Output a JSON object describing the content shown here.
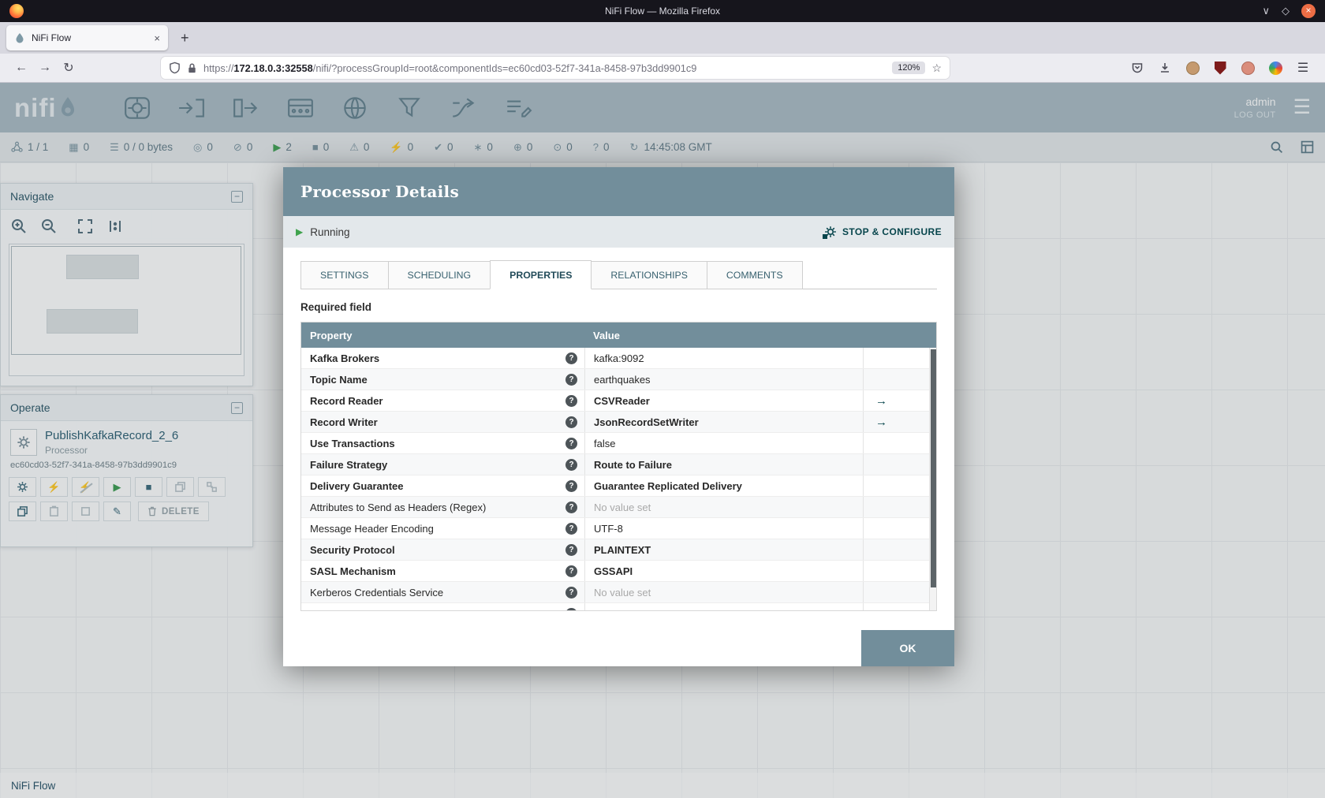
{
  "browser": {
    "window_title": "NiFi Flow — Mozilla Firefox",
    "tab_title": "NiFi Flow",
    "url_scheme": "https://",
    "url_host": "172.18.0.3:32558",
    "url_path": "/nifi/?processGroupId=root&componentIds=ec60cd03-52f7-341a-8458-97b3dd9901c9",
    "zoom_level": "120%"
  },
  "icons": {
    "close": "×",
    "menu": "☰",
    "chevron-down": "∨",
    "restore": "◇",
    "back": "←",
    "forward": "→",
    "reload": "↻",
    "star": "☆",
    "plus": "+",
    "collapse": "−",
    "help": "?",
    "goto": "→",
    "bolt": "⚡",
    "play": "▶",
    "stop": "■",
    "pencil": "✎",
    "threads": "▦",
    "queue": "☰",
    "transmitting": "◎",
    "not-transmitting": "⊘",
    "running": "▶",
    "stopped": "■",
    "invalid": "⚠",
    "disabled": "⚡",
    "up-to-date": "✔",
    "locally-modified": "∗",
    "stale": "⊕",
    "modified-stale": "⊙",
    "sync-failure": "?",
    "refresh": "↻"
  },
  "nifi": {
    "logo_word": "nifi",
    "user": "admin",
    "logout_label": "LOG OUT",
    "status_bar": {
      "items": [
        {
          "icon": "cluster",
          "value": "1 / 1"
        },
        {
          "icon": "threads",
          "value": "0"
        },
        {
          "icon": "queue",
          "value": "0 / 0 bytes"
        },
        {
          "icon": "transmitting",
          "value": "0"
        },
        {
          "icon": "not-transmitting",
          "value": "0"
        },
        {
          "icon": "running",
          "value": "2",
          "color": "green"
        },
        {
          "icon": "stopped",
          "value": "0"
        },
        {
          "icon": "invalid",
          "value": "0"
        },
        {
          "icon": "disabled",
          "value": "0"
        },
        {
          "icon": "up-to-date",
          "value": "0"
        },
        {
          "icon": "locally-modified",
          "value": "0"
        },
        {
          "icon": "stale",
          "value": "0"
        },
        {
          "icon": "modified-stale",
          "value": "0"
        },
        {
          "icon": "sync-failure",
          "value": "0"
        }
      ],
      "refresh_time": "14:45:08 GMT"
    },
    "navigate_title": "Navigate",
    "operate_title": "Operate",
    "component_name": "PublishKafkaRecord_2_6",
    "component_type": "Processor",
    "component_id": "ec60cd03-52f7-341a-8458-97b3dd9901c9",
    "delete_label": "DELETE",
    "breadcrumb": "NiFi Flow"
  },
  "dialog": {
    "title": "Processor Details",
    "status_label": "Running",
    "stop_configure_label": "STOP & CONFIGURE",
    "tabs": [
      {
        "label": "SETTINGS",
        "active": false
      },
      {
        "label": "SCHEDULING",
        "active": false
      },
      {
        "label": "PROPERTIES",
        "active": true
      },
      {
        "label": "RELATIONSHIPS",
        "active": false
      },
      {
        "label": "COMMENTS",
        "active": false
      }
    ],
    "required_field_label": "Required field",
    "table": {
      "columns": [
        "Property",
        "Value"
      ],
      "rows": [
        {
          "property": "Kafka Brokers",
          "required": true,
          "value": "kafka:9092"
        },
        {
          "property": "Topic Name",
          "required": true,
          "value": "earthquakes"
        },
        {
          "property": "Record Reader",
          "required": true,
          "value": "CSVReader",
          "strong": true,
          "goto": true
        },
        {
          "property": "Record Writer",
          "required": true,
          "value": "JsonRecordSetWriter",
          "strong": true,
          "goto": true
        },
        {
          "property": "Use Transactions",
          "required": true,
          "value": "false"
        },
        {
          "property": "Failure Strategy",
          "required": true,
          "value": "Route to Failure",
          "strong": true
        },
        {
          "property": "Delivery Guarantee",
          "required": true,
          "value": "Guarantee Replicated Delivery",
          "strong": true
        },
        {
          "property": "Attributes to Send as Headers (Regex)",
          "required": false,
          "value": "No value set",
          "unset": true
        },
        {
          "property": "Message Header Encoding",
          "required": false,
          "value": "UTF-8"
        },
        {
          "property": "Security Protocol",
          "required": true,
          "value": "PLAINTEXT",
          "strong": true
        },
        {
          "property": "SASL Mechanism",
          "required": true,
          "value": "GSSAPI",
          "strong": true
        },
        {
          "property": "Kerberos Credentials Service",
          "required": false,
          "value": "No value set",
          "unset": true
        },
        {
          "property": "",
          "required": false,
          "value": "",
          "partial": true
        }
      ]
    },
    "ok_label": "OK"
  },
  "colors": {
    "accent": "#728e9b",
    "dialog_status_bg": "#e3e8eb",
    "running_green": "#3fa34d",
    "link_teal": "#07454c"
  }
}
